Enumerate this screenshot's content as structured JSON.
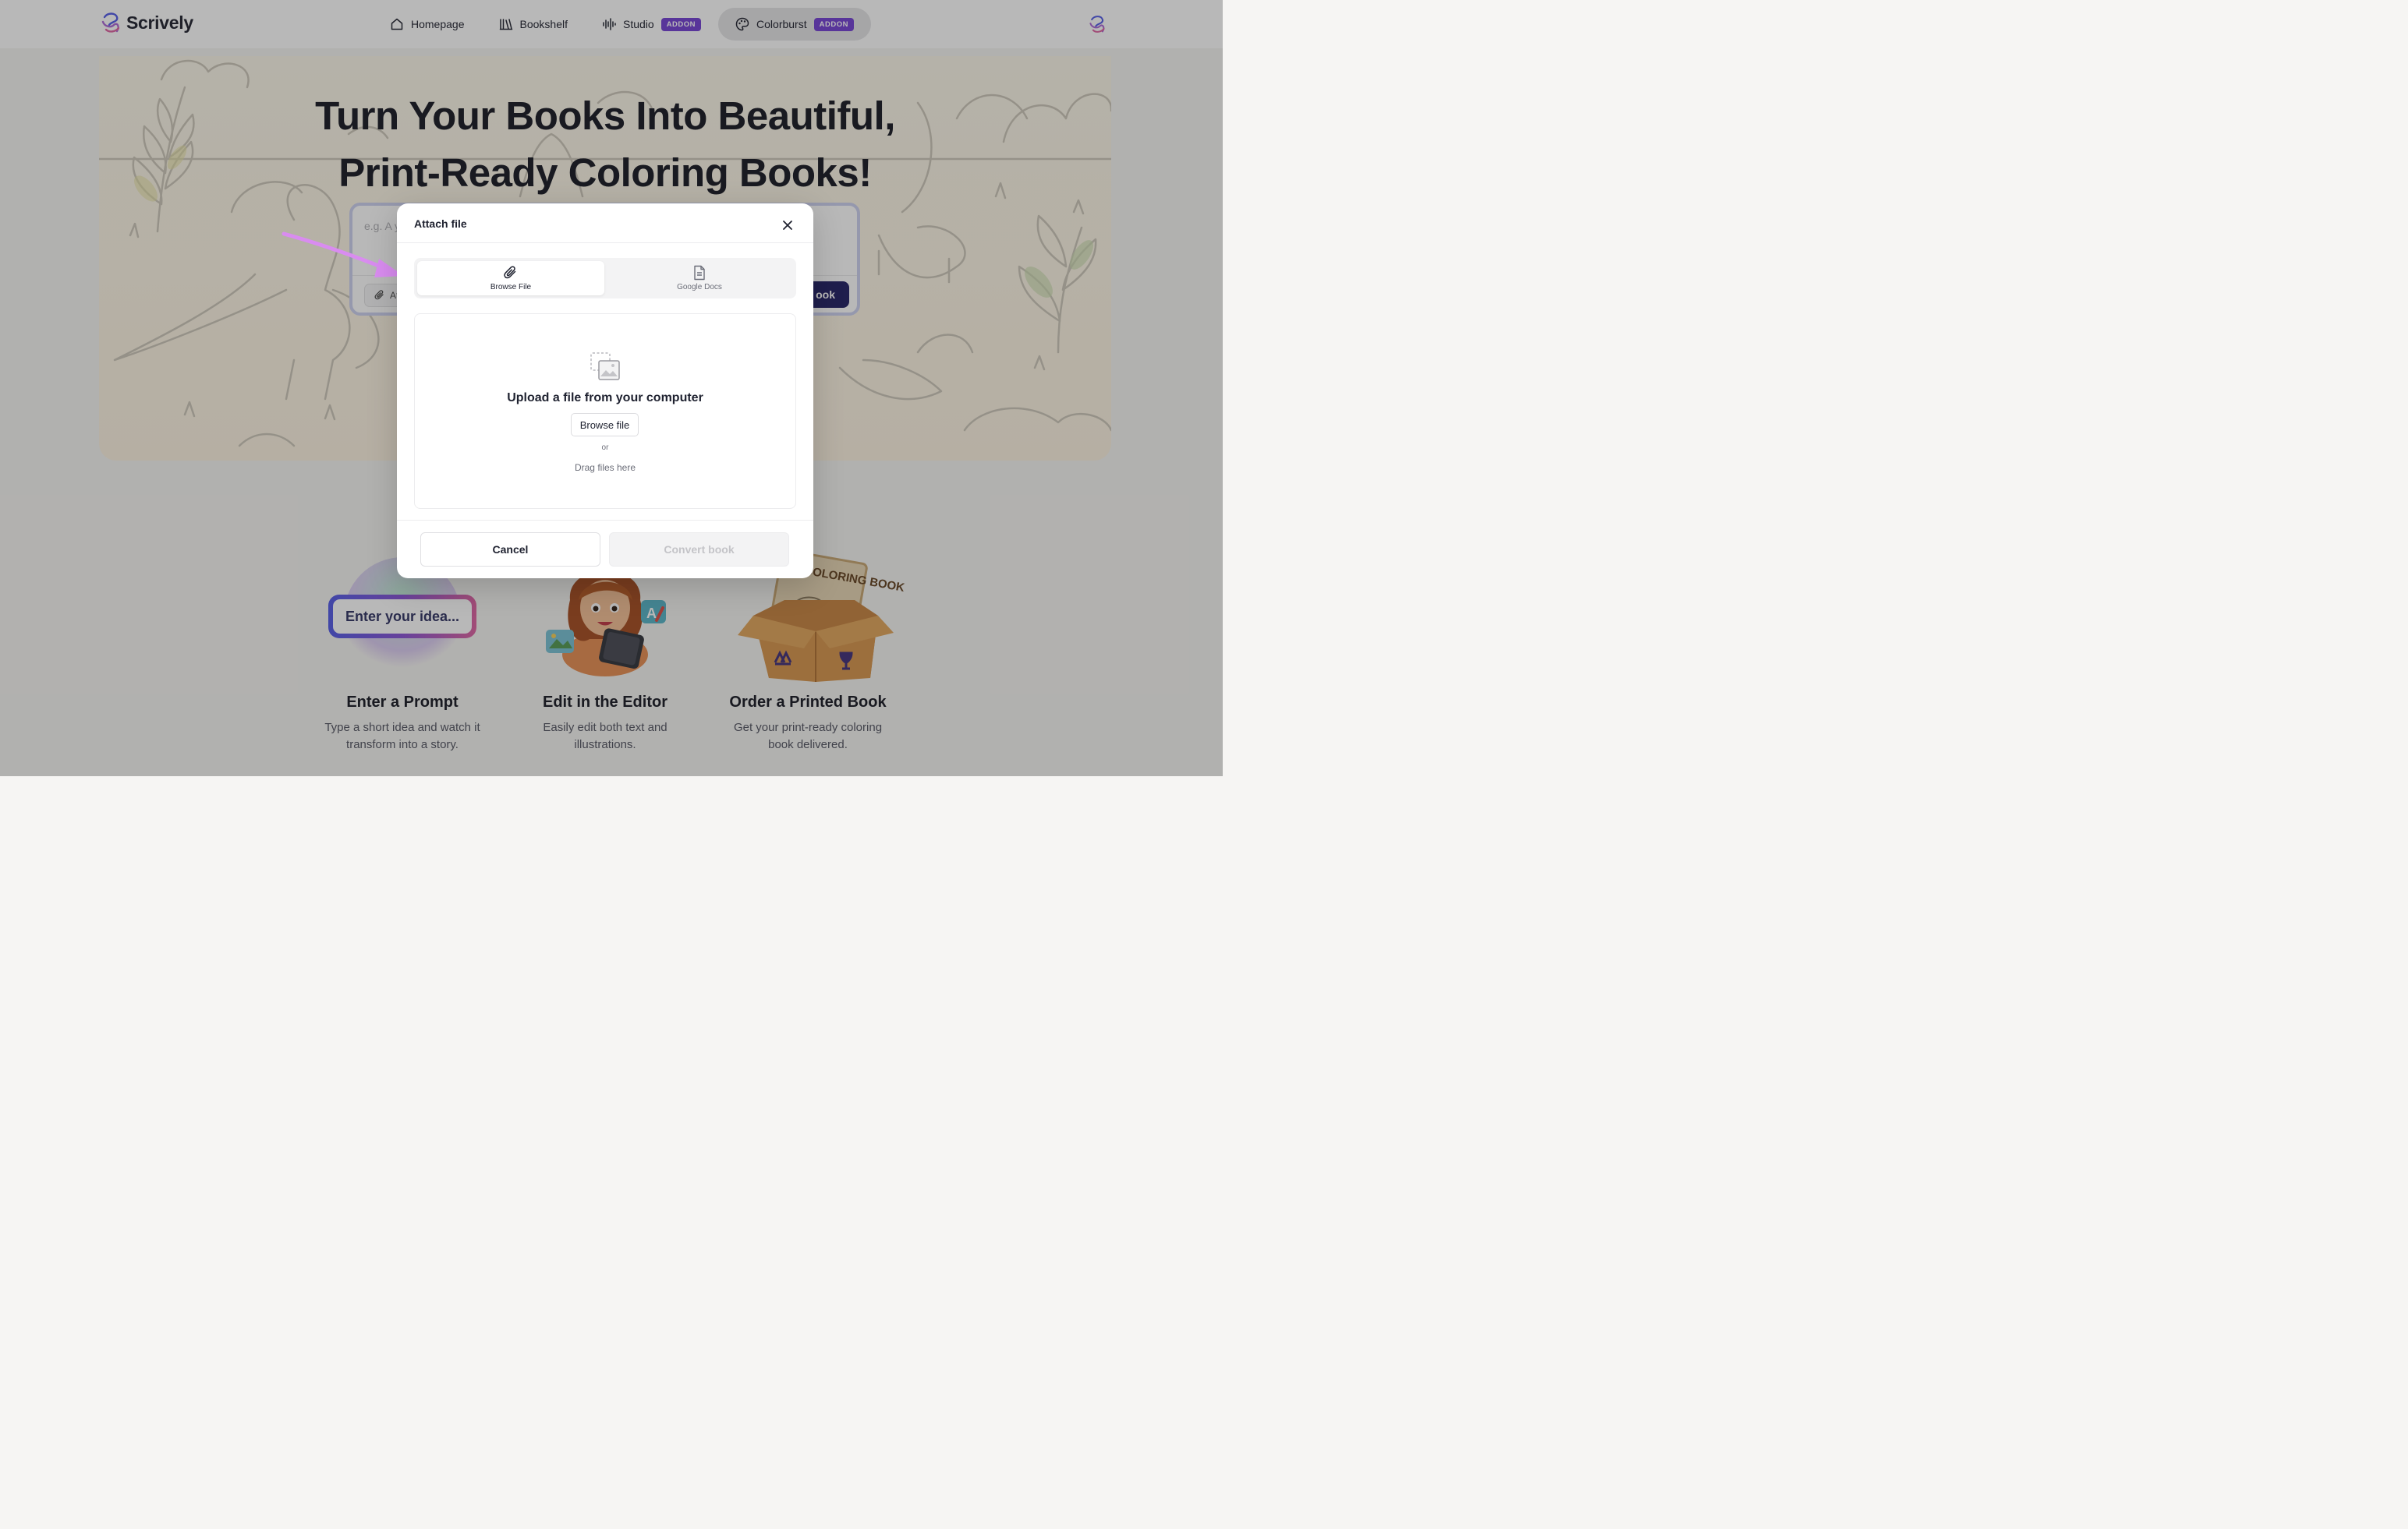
{
  "brand": {
    "name": "Scrively",
    "logo_icon": "scrively-swirl-icon"
  },
  "nav": {
    "items": [
      {
        "label": "Homepage",
        "icon": "home-icon"
      },
      {
        "label": "Bookshelf",
        "icon": "bookshelf-icon"
      },
      {
        "label": "Studio",
        "icon": "audio-wave-icon",
        "badge": "ADDON"
      },
      {
        "label": "Colorburst",
        "icon": "palette-icon",
        "badge": "ADDON",
        "active": true
      }
    ]
  },
  "hero": {
    "title_line1": "Turn Your Books Into Beautiful,",
    "title_line2": "Print-Ready Coloring Books!",
    "prompt_placeholder": "e.g. A y",
    "attach_label": "Att",
    "create_label": "ook"
  },
  "steps": [
    {
      "title": "Enter a Prompt",
      "description": "Type a short idea and watch it transform into a story.",
      "illustration_text": "Enter your idea..."
    },
    {
      "title": "Edit in the Editor",
      "description": "Easily edit both text and illustrations."
    },
    {
      "title": "Order a Printed Book",
      "description": "Get your print-ready coloring book delivered.",
      "illustration_text": "COLORING BOOK"
    }
  ],
  "modal": {
    "title": "Attach file",
    "tabs": [
      {
        "label": "Browse File",
        "icon": "paperclip-icon",
        "active": true
      },
      {
        "label": "Google Docs",
        "icon": "document-icon",
        "active": false
      }
    ],
    "upload_title": "Upload a file from your computer",
    "browse_label": "Browse file",
    "or_label": "or",
    "drag_label": "Drag files here",
    "cancel_label": "Cancel",
    "convert_label": "Convert book"
  },
  "colors": {
    "accent": "#7b4ad6",
    "primary_button": "#2c2a6b",
    "annotation_arrow": "#d98cf0"
  }
}
